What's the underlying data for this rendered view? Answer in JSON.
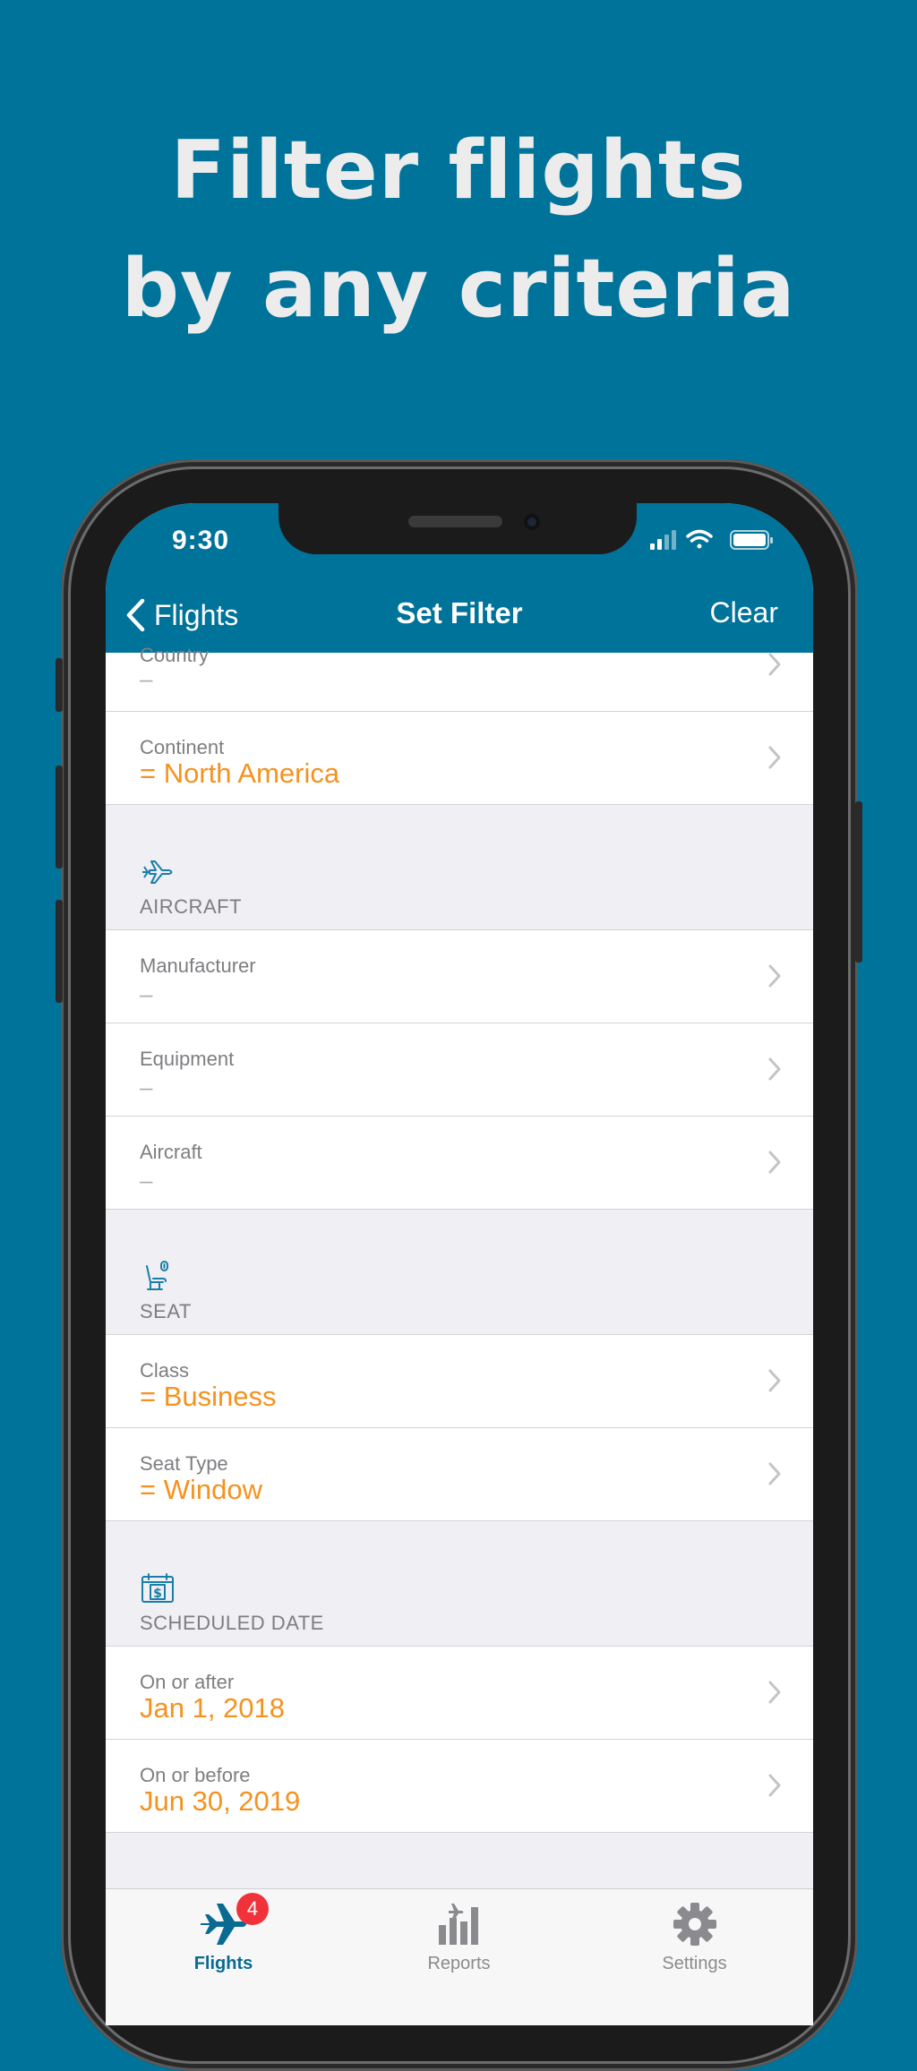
{
  "headline": {
    "line1": "Filter flights",
    "line2": "by any criteria"
  },
  "status_bar": {
    "time": "9:30"
  },
  "nav": {
    "back_label": "Flights",
    "title": "Set Filter",
    "right_label": "Clear"
  },
  "partial_row": {
    "label": "Country",
    "value": "–"
  },
  "location_rows": [
    {
      "label": "Continent",
      "value": "= North America"
    }
  ],
  "aircraft_section": {
    "title": "AIRCRAFT",
    "icon": "airplane-icon",
    "rows": [
      {
        "label": "Manufacturer",
        "value": "–"
      },
      {
        "label": "Equipment",
        "value": "–"
      },
      {
        "label": "Aircraft",
        "value": "–"
      }
    ]
  },
  "seat_section": {
    "title": "SEAT",
    "icon": "seat-icon",
    "rows": [
      {
        "label": "Class",
        "value": "= Business"
      },
      {
        "label": "Seat Type",
        "value": "= Window"
      }
    ]
  },
  "date_section": {
    "title": "SCHEDULED DATE",
    "icon": "calendar-icon",
    "rows": [
      {
        "label": "On or after",
        "value": "Jan 1, 2018"
      },
      {
        "label": "On or before",
        "value": "Jun 30, 2019"
      }
    ]
  },
  "tabbar": {
    "tabs": [
      {
        "label": "Flights",
        "icon": "airplane-icon",
        "badge": "4",
        "active": true
      },
      {
        "label": "Reports",
        "icon": "bar-chart-icon",
        "active": false
      },
      {
        "label": "Settings",
        "icon": "gear-icon",
        "active": false
      }
    ]
  },
  "colors": {
    "brand": "#00739a",
    "value_set": "#f5921e",
    "badge": "#f0333a"
  }
}
